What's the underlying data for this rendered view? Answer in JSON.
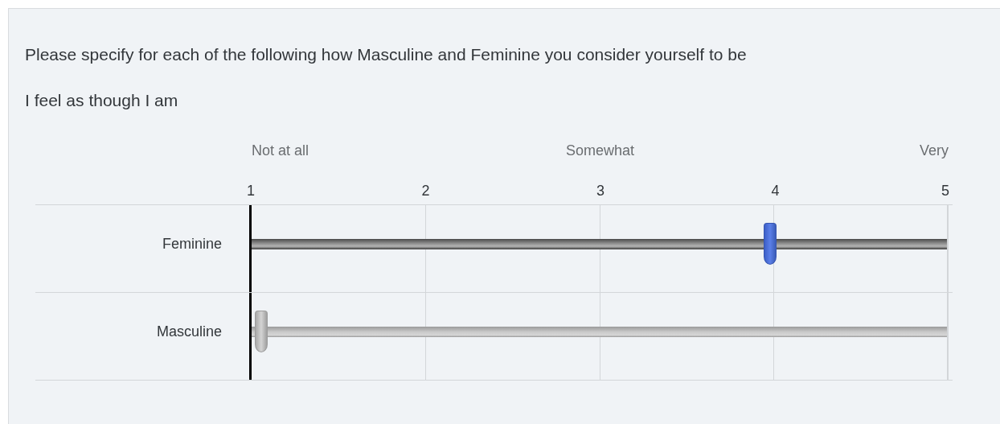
{
  "question": "Please specify for each of the following how Masculine and Feminine you consider yourself to be",
  "statement": "I feel as though I am",
  "scale": {
    "anchors": [
      "Not at all",
      "Somewhat",
      "Very"
    ],
    "ticks": [
      "1",
      "2",
      "3",
      "4",
      "5"
    ]
  },
  "items": [
    {
      "label": "Feminine",
      "answered": true,
      "level": 0.75
    },
    {
      "label": "Masculine",
      "answered": false,
      "level": 0
    }
  ]
}
